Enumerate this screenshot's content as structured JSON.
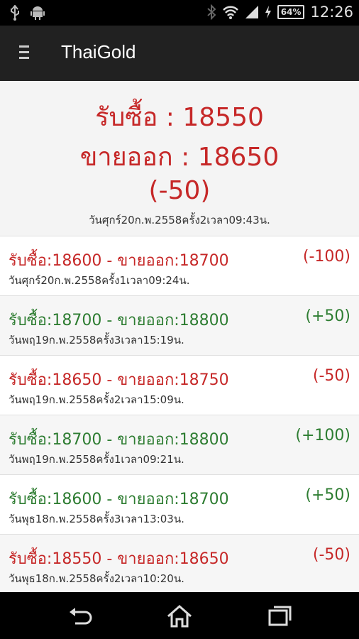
{
  "status_bar": {
    "time": "12:26",
    "battery": "64%",
    "icons": [
      "usb-icon",
      "android-icon",
      "bluetooth-icon",
      "wifi-icon",
      "signal-icon",
      "charging-icon",
      "battery-icon"
    ]
  },
  "app_bar": {
    "title": "ThaiGold"
  },
  "latest": {
    "buy": "รับซื้อ : 18550",
    "sell": "ขายออก : 18650",
    "change": "(-50)",
    "timestamp": "วันศุกร์20ก.พ.2558ครั้ง2เวลา09:43น.",
    "color": "#c62828"
  },
  "history": [
    {
      "text": "รับซื้อ:18600 - ขายออก:18700",
      "change": "(-100)",
      "time": "วันศุกร์20ก.พ.2558ครั้ง1เวลา09:24น.",
      "trend": "down"
    },
    {
      "text": "รับซื้อ:18700 - ขายออก:18800",
      "change": "(+50)",
      "time": "วันพฤ19ก.พ.2558ครั้ง3เวลา15:19น.",
      "trend": "up"
    },
    {
      "text": "รับซื้อ:18650 - ขายออก:18750",
      "change": "(-50)",
      "time": "วันพฤ19ก.พ.2558ครั้ง2เวลา15:09น.",
      "trend": "down"
    },
    {
      "text": "รับซื้อ:18700 - ขายออก:18800",
      "change": "(+100)",
      "time": "วันพฤ19ก.พ.2558ครั้ง1เวลา09:21น.",
      "trend": "up"
    },
    {
      "text": "รับซื้อ:18600 - ขายออก:18700",
      "change": "(+50)",
      "time": "วันพุธ18ก.พ.2558ครั้ง3เวลา13:03น.",
      "trend": "up"
    },
    {
      "text": "รับซื้อ:18550 - ขายออก:18650",
      "change": "(-50)",
      "time": "วันพุธ18ก.พ.2558ครั้ง2เวลา10:20น.",
      "trend": "down"
    }
  ],
  "colors": {
    "down": "#c62828",
    "up": "#2e7d32",
    "app_bar": "#212121"
  },
  "nav_bar": {
    "buttons": [
      "back-icon",
      "home-icon",
      "recents-icon"
    ]
  }
}
